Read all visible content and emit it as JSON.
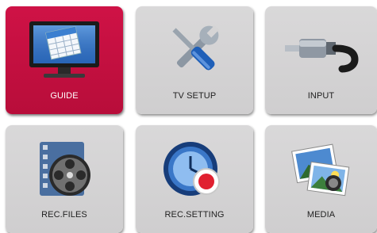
{
  "menu": {
    "tiles": [
      {
        "label": "GUIDE",
        "icon": "tv-guide-icon",
        "selected": true
      },
      {
        "label": "TV SETUP",
        "icon": "tools-icon",
        "selected": false
      },
      {
        "label": "INPUT",
        "icon": "rca-cable-icon",
        "selected": false
      },
      {
        "label": "REC.FILES",
        "icon": "film-reel-icon",
        "selected": false
      },
      {
        "label": "REC.SETTING",
        "icon": "record-clock-icon",
        "selected": false
      },
      {
        "label": "MEDIA",
        "icon": "photo-media-icon",
        "selected": false
      }
    ]
  },
  "colors": {
    "selected_tile": "#c40f40",
    "tile": "#d5d4d5"
  }
}
